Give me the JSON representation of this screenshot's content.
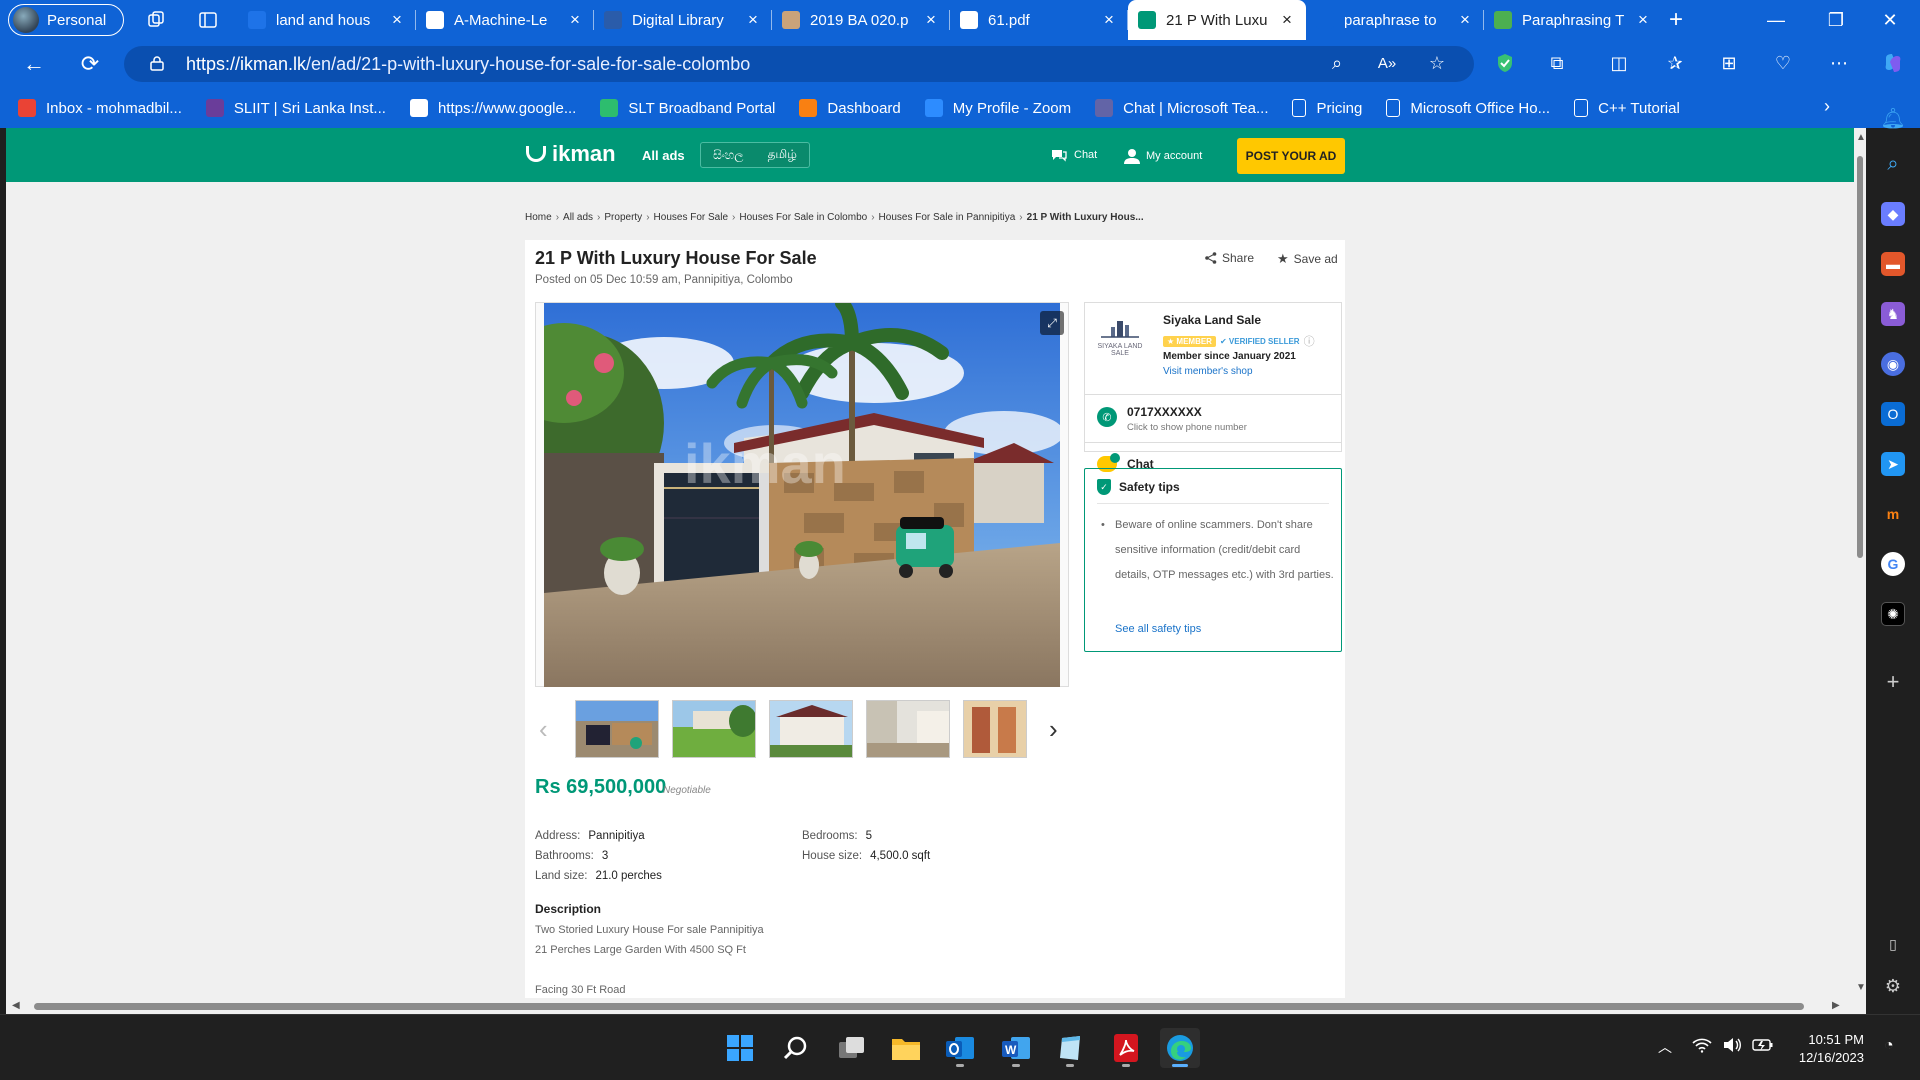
{
  "browser": {
    "profile_label": "Personal",
    "tabs": [
      {
        "title": "land and hous",
        "favicon": "blue-diamond-icon",
        "color": "#1e73e8"
      },
      {
        "title": "A-Machine-Le",
        "favicon": "researchgate-icon",
        "color": "#ffffff"
      },
      {
        "title": "Digital Library",
        "favicon": "digital-library-icon",
        "color": "#2a5caa"
      },
      {
        "title": "2019 BA 020.p",
        "favicon": "document-thumbnail-icon",
        "color": "#c9a37a"
      },
      {
        "title": "61.pdf",
        "favicon": "file-icon",
        "color": "#ffffff"
      },
      {
        "title": "21 P With Luxu",
        "favicon": "ikman-icon",
        "color": "#009877",
        "active": true
      },
      {
        "title": "paraphrase to",
        "favicon": "blank-icon",
        "color": "#0f63d6"
      },
      {
        "title": "Paraphrasing T",
        "favicon": "quillbot-icon",
        "color": "#4caf50"
      }
    ],
    "url_host": "https://ikman.lk",
    "url_path": "/en/ad/21-p-with-luxury-house-for-sale-for-sale-colombo",
    "favorites": [
      {
        "label": "Inbox - mohmadbil...",
        "icon": "gmail-icon",
        "color": "#ea4335"
      },
      {
        "label": "SLIIT | Sri Lanka Inst...",
        "icon": "sliit-icon",
        "color": "#6a3d9a"
      },
      {
        "label": "https://www.google...",
        "icon": "google-icon",
        "color": "#ffffff"
      },
      {
        "label": "SLT Broadband Portal",
        "icon": "slt-icon",
        "color": "#2dbd6e"
      },
      {
        "label": "Dashboard",
        "icon": "moodle-icon",
        "color": "#f98012"
      },
      {
        "label": "My Profile - Zoom",
        "icon": "zoom-icon",
        "color": "#2d8cff"
      },
      {
        "label": "Chat | Microsoft Tea...",
        "icon": "teams-icon",
        "color": "#6264a7"
      },
      {
        "label": "Pricing",
        "icon": "file-icon",
        "color": "#ffffff"
      },
      {
        "label": "Microsoft Office Ho...",
        "icon": "file-icon",
        "color": "#ffffff"
      },
      {
        "label": "C++ Tutorial",
        "icon": "file-icon",
        "color": "#ffffff"
      }
    ]
  },
  "site": {
    "logo_text": "ikman",
    "all_ads": "All ads",
    "lang_sinhala": "සිංහල",
    "lang_tamil": "தமிழ்",
    "chat": "Chat",
    "my_account": "My account",
    "post_ad": "POST YOUR AD",
    "brand_color": "#009877",
    "accent_color": "#ffc800"
  },
  "breadcrumb": [
    "Home",
    "All ads",
    "Property",
    "Houses For Sale",
    "Houses For Sale in Colombo",
    "Houses For Sale in Pannipitiya",
    "21 P With Luxury Hous..."
  ],
  "ad": {
    "title": "21 P With Luxury House For Sale",
    "posted": "Posted on 05 Dec 10:59 am, Pannipitiya, Colombo",
    "share": "Share",
    "save": "Save ad",
    "watermark": "ikman",
    "price": "Rs 69,500,000",
    "negotiable": "Negotiable",
    "details": {
      "address_label": "Address:",
      "address": "Pannipitiya",
      "bedrooms_label": "Bedrooms:",
      "bedrooms": "5",
      "bathrooms_label": "Bathrooms:",
      "bathrooms": "3",
      "house_size_label": "House size:",
      "house_size": "4,500.0 sqft",
      "land_size_label": "Land size:",
      "land_size": "21.0 perches"
    },
    "description_heading": "Description",
    "description_lines": [
      "Two Storied Luxury House For sale Pannipitiya",
      "21 Perches Large Garden With 4500 SQ Ft",
      "",
      "Facing 30 Ft Road"
    ]
  },
  "seller": {
    "name": "Siyaka Land Sale",
    "member_badge": "MEMBER",
    "verified_badge": "VERIFIED SELLER",
    "member_since": "Member since January 2021",
    "visit_shop": "Visit member's shop",
    "phone": "0717XXXXXX",
    "phone_hint": "Click to show phone number",
    "chat": "Chat",
    "logo_caption": "SIYAKA LAND SALE"
  },
  "safety": {
    "heading": "Safety tips",
    "text": "Beware of online scammers. Don't share sensitive information (credit/debit card details, OTP messages etc.) with 3rd parties.",
    "link": "See all safety tips"
  },
  "taskbar": {
    "time": "10:51 PM",
    "date": "12/16/2023",
    "apps": [
      "start-icon",
      "search-icon",
      "task-view-icon",
      "file-explorer-icon",
      "outlook-icon",
      "word-icon",
      "notepad-icon",
      "acrobat-icon",
      "edge-icon"
    ]
  }
}
